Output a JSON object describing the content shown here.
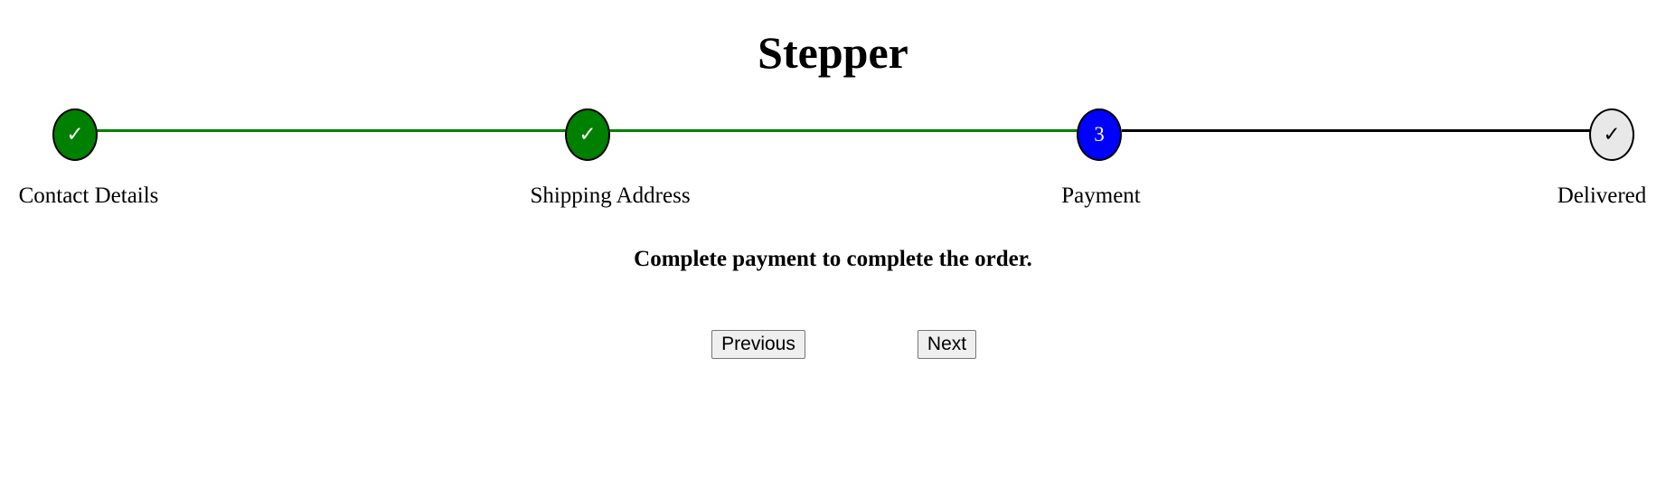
{
  "page": {
    "title": "Stepper",
    "message": "Complete payment to complete the order."
  },
  "steps": [
    {
      "label": "Contact Details",
      "indicator": "✓",
      "status": "completed"
    },
    {
      "label": "Shipping Address",
      "indicator": "✓",
      "status": "completed"
    },
    {
      "label": "Payment",
      "indicator": "3",
      "status": "active"
    },
    {
      "label": "Delivered",
      "indicator": "✓",
      "status": "pending"
    }
  ],
  "connectors": [
    {
      "status": "completed"
    },
    {
      "status": "completed"
    },
    {
      "status": "pending"
    }
  ],
  "colors": {
    "completed": "#008000",
    "active": "#0000ff",
    "pending": "#e8e8e8",
    "connector_completed": "#008000",
    "connector_pending": "#000000"
  },
  "buttons": {
    "previous": "Previous",
    "next": "Next"
  }
}
